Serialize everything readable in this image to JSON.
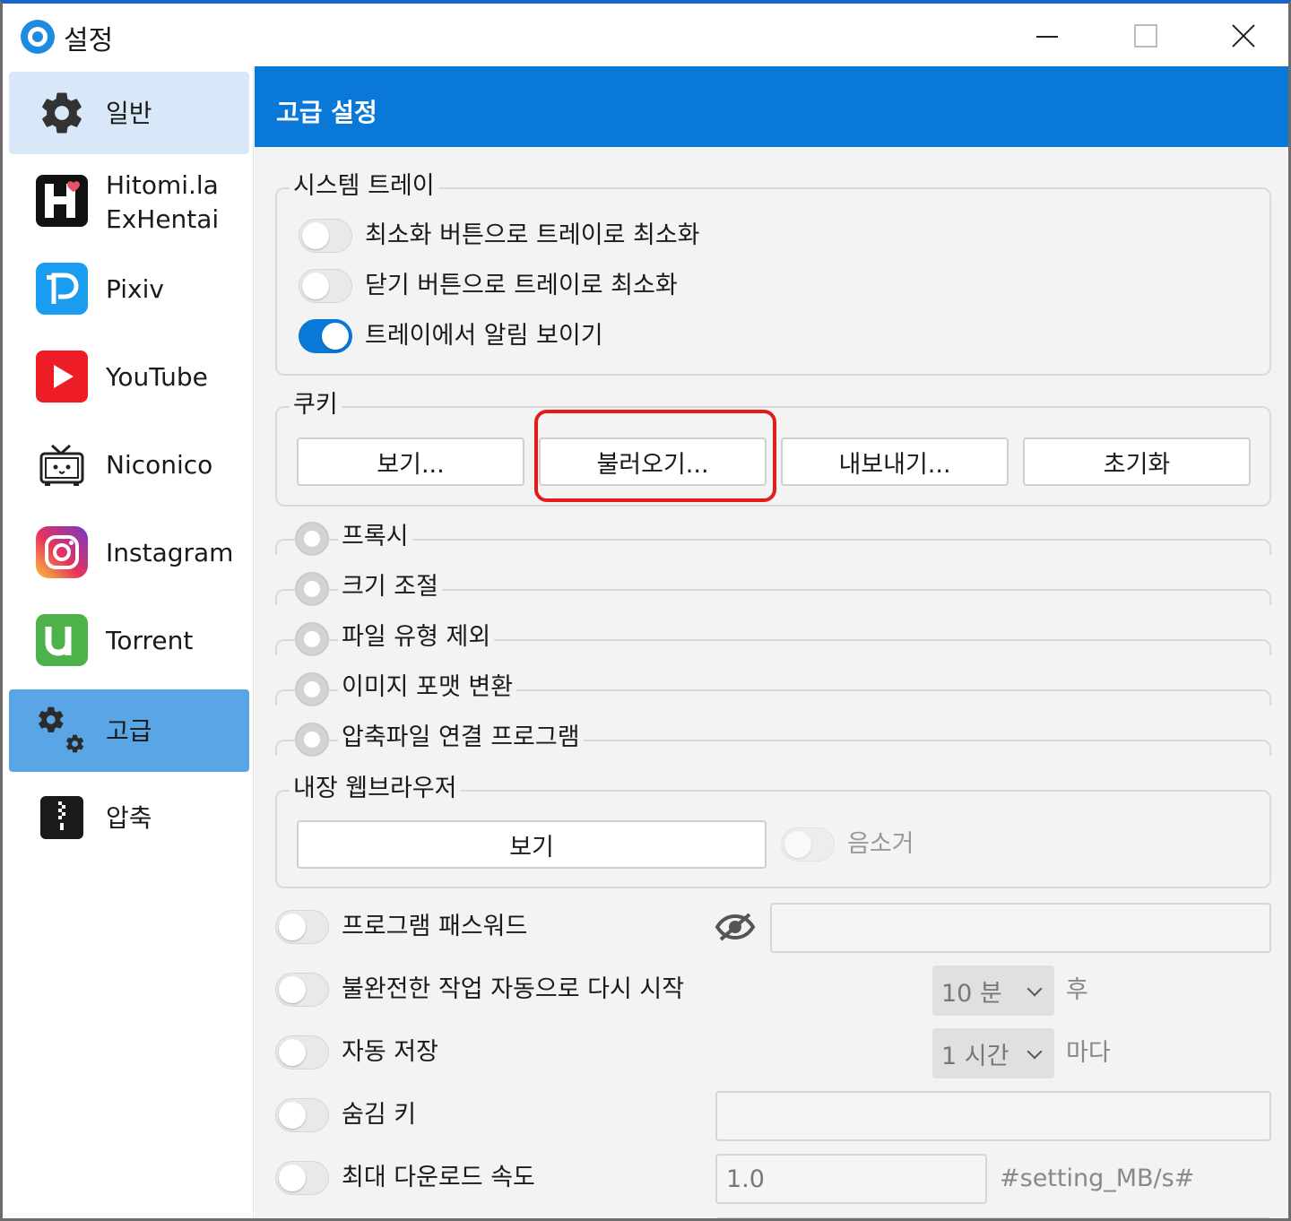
{
  "window": {
    "title": "설정"
  },
  "sidebar": {
    "items": [
      {
        "label": "일반",
        "icon": "gear-icon"
      },
      {
        "label": "Hitomi.la\nExHentai",
        "label1": "Hitomi.la",
        "label2": "ExHentai",
        "icon": "hitomi-icon"
      },
      {
        "label": "Pixiv",
        "icon": "pixiv-icon"
      },
      {
        "label": "YouTube",
        "icon": "youtube-icon"
      },
      {
        "label": "Niconico",
        "icon": "niconico-icon"
      },
      {
        "label": "Instagram",
        "icon": "instagram-icon"
      },
      {
        "label": "Torrent",
        "icon": "utorrent-icon"
      },
      {
        "label": "고급",
        "icon": "gears-icon"
      },
      {
        "label": "압축",
        "icon": "zip-icon"
      }
    ]
  },
  "header": {
    "title": "고급 설정",
    "color": "#0a78d7"
  },
  "system_tray": {
    "legend": "시스템 트레이",
    "options": [
      {
        "label": "최소화 버튼으로 트레이로 최소화",
        "on": false
      },
      {
        "label": "닫기 버튼으로 트레이로 최소화",
        "on": false
      },
      {
        "label": "트레이에서 알림 보이기",
        "on": true
      }
    ]
  },
  "cookies": {
    "legend": "쿠키",
    "buttons": [
      "보기...",
      "불러오기...",
      "내보내기...",
      "초기화"
    ]
  },
  "radio_sections": [
    "프록시",
    "크기 조절",
    "파일 유형 제외",
    "이미지 포맷 변환",
    "압축파일 연결 프로그램"
  ],
  "browser": {
    "legend": "내장 웹브라우저",
    "view_button": "보기",
    "mute_label": "음소거"
  },
  "settings": {
    "password_label": "프로그램 패스워드",
    "restart_label": "불완전한 작업 자동으로 다시 시작",
    "restart_value": "10 분",
    "restart_suffix": "후",
    "autosave_label": "자동 저장",
    "autosave_value": "1 시간",
    "autosave_suffix": "마다",
    "hide_key_label": "숨김 키",
    "max_speed_label": "최대 다운로드 속도",
    "max_speed_value": "1.0",
    "max_speed_unit": "#setting_MB/s#"
  },
  "colors": {
    "accent": "#0a78d7",
    "selected_sidebar": "#5aa5e6",
    "highlight": "#e31b1b"
  }
}
